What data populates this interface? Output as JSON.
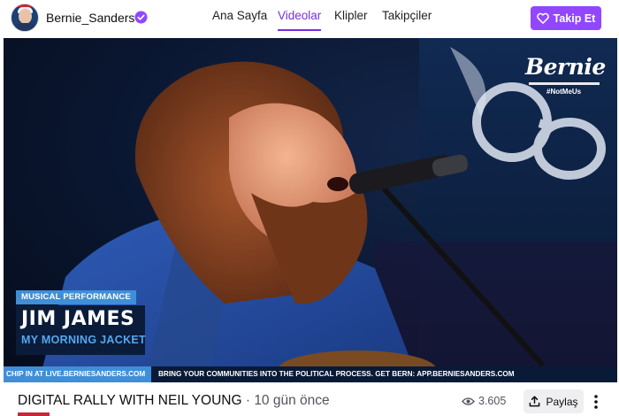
{
  "channel": {
    "name": "Bernie_Sanders",
    "avatar_icon": "bernie-avatar",
    "verified_icon": "verified-badge-icon",
    "accent": "#9147ff"
  },
  "nav": {
    "tabs": [
      {
        "label": "Ana Sayfa",
        "active": false
      },
      {
        "label": "Videolar",
        "active": true
      },
      {
        "label": "Klipler",
        "active": false
      },
      {
        "label": "Takipçiler",
        "active": false
      }
    ]
  },
  "follow": {
    "label": "Takip Et",
    "icon": "heart-icon"
  },
  "video": {
    "overlay": {
      "brand": "Bernie",
      "hashtag": "#NotMeUs",
      "segment_tag": "MUSICAL PERFORMANCE",
      "performer": "JIM JAMES",
      "band": "MY MORNING JACKET",
      "ticker_left": "CHIP IN AT LIVE.BERNIESANDERS.COM",
      "ticker_right": "BRING YOUR COMMUNITIES INTO THE POLITICAL PROCESS. GET BERN: APP.BERNIESANDERS.COM"
    }
  },
  "info": {
    "title": "DIGITAL RALLY WITH NEIL YOUNG",
    "separator": "·",
    "age": "10 gün önce",
    "views": "3.605",
    "view_icon": "eye-icon",
    "share_label": "Paylaş",
    "share_icon": "share-upload-icon",
    "more_icon": "more-vertical-icon"
  }
}
